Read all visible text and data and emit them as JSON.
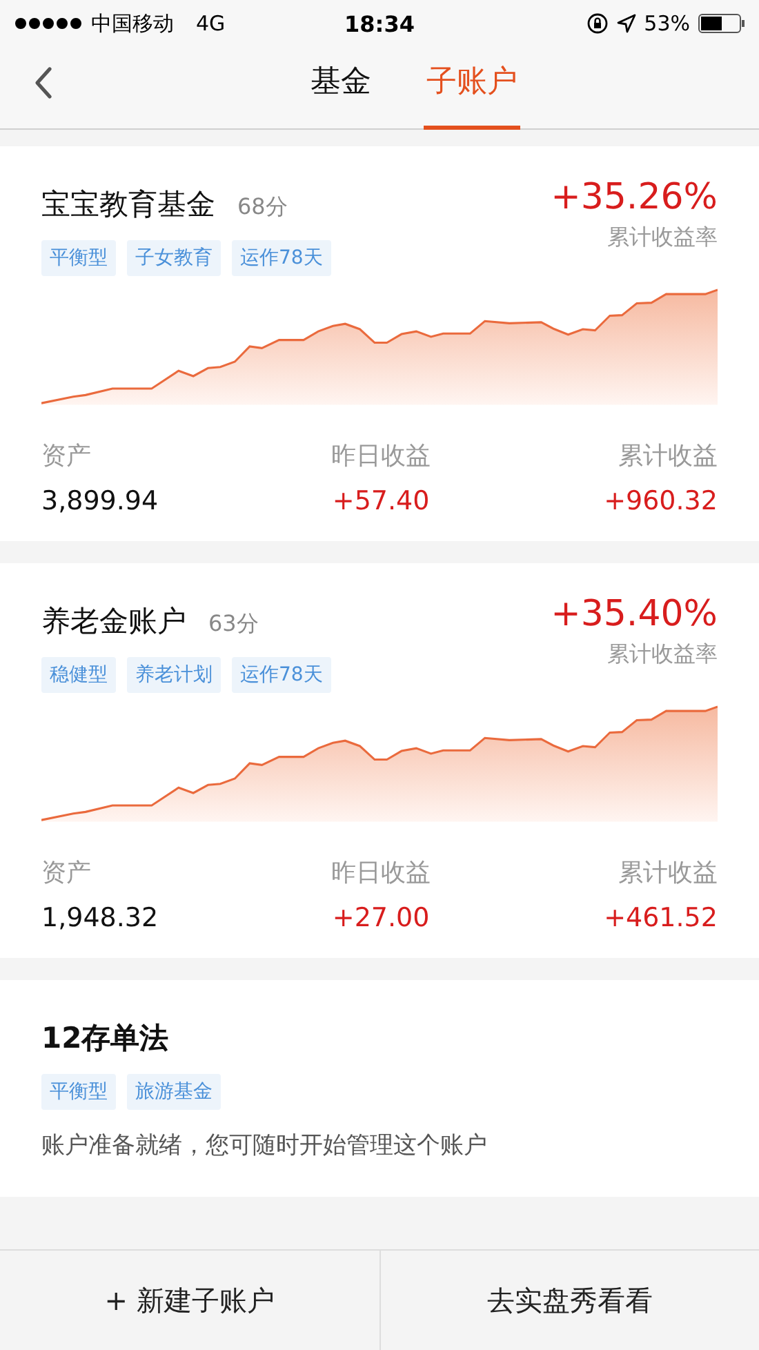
{
  "status_bar": {
    "carrier": "中国移动",
    "network": "4G",
    "time": "18:34",
    "battery": "53%"
  },
  "nav": {
    "tabs": [
      {
        "label": "基金",
        "selected": false
      },
      {
        "label": "子账户",
        "selected": true
      }
    ]
  },
  "accounts": [
    {
      "kind": "chart",
      "name": "宝宝教育基金",
      "score": "68分",
      "return": "+35.26%",
      "return_label": "累计收益率",
      "tags": [
        "平衡型",
        "子女教育",
        "运作78天"
      ],
      "stats": [
        {
          "label": "资产",
          "value": "3,899.94",
          "positive": false
        },
        {
          "label": "昨日收益",
          "value": "+57.40",
          "positive": true
        },
        {
          "label": "累计收益",
          "value": "+960.32",
          "positive": true
        }
      ]
    },
    {
      "kind": "chart",
      "name": "养老金账户",
      "score": "63分",
      "return": "+35.40%",
      "return_label": "累计收益率",
      "tags": [
        "稳健型",
        "养老计划",
        "运作78天"
      ],
      "stats": [
        {
          "label": "资产",
          "value": "1,948.32",
          "positive": false
        },
        {
          "label": "昨日收益",
          "value": "+27.00",
          "positive": true
        },
        {
          "label": "累计收益",
          "value": "+461.52",
          "positive": true
        }
      ]
    },
    {
      "kind": "empty",
      "name": "12存单法",
      "tags": [
        "平衡型",
        "旅游基金"
      ],
      "note": "账户准备就绪，您可随时开始管理这个账户"
    }
  ],
  "footer": {
    "buttons": [
      "+ 新建子账户",
      "去实盘秀看看"
    ]
  }
}
